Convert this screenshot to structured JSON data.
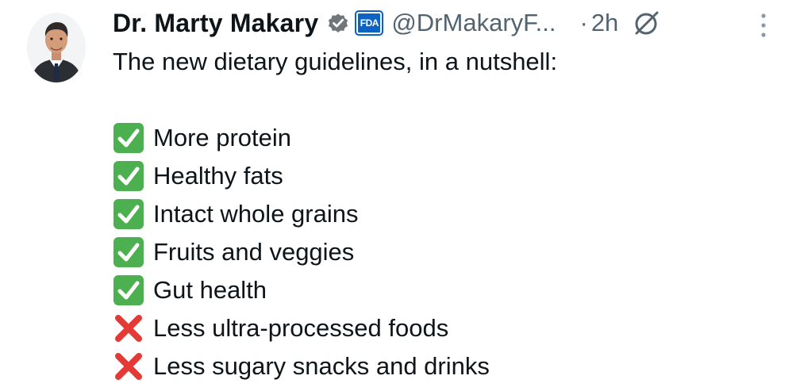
{
  "author": {
    "display_name": "Dr. Marty Makary",
    "handle": "@DrMakaryF...",
    "affiliate_badge_text": "FDA",
    "verified_icon": "verified-badge-icon",
    "verified_color": "#71767b"
  },
  "meta": {
    "separator": "·",
    "time": "2h",
    "grok_icon": "grok-icon",
    "more_icon": "more-options-icon"
  },
  "tweet": {
    "intro": "The new dietary guidelines, in a nutshell:",
    "items": [
      {
        "icon": "check-mark-emoji-icon",
        "text": "More protein",
        "status": "positive"
      },
      {
        "icon": "check-mark-emoji-icon",
        "text": "Healthy fats",
        "status": "positive"
      },
      {
        "icon": "check-mark-emoji-icon",
        "text": "Intact whole grains",
        "status": "positive"
      },
      {
        "icon": "check-mark-emoji-icon",
        "text": "Fruits and veggies",
        "status": "positive"
      },
      {
        "icon": "check-mark-emoji-icon",
        "text": "Gut health",
        "status": "positive"
      },
      {
        "icon": "cross-mark-emoji-icon",
        "text": "Less ultra-processed foods",
        "status": "negative"
      },
      {
        "icon": "cross-mark-emoji-icon",
        "text": "Less sugary snacks and drinks",
        "status": "negative"
      }
    ]
  },
  "colors": {
    "text_primary": "#0f1419",
    "text_secondary": "#536471",
    "check_green": "#4caf50",
    "cross_red": "#e53935",
    "fda_blue": "#0b63c6"
  }
}
